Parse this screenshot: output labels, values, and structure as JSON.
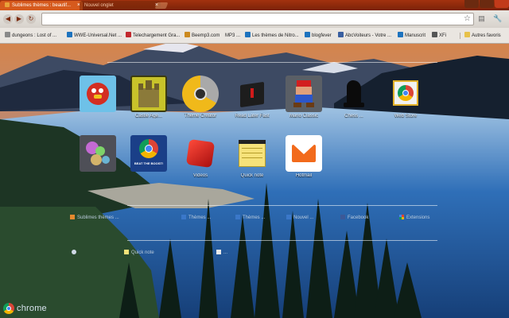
{
  "tabs": [
    {
      "label": "Sublimes thèmes : beautif...",
      "active": true
    },
    {
      "label": "Nouvel onglet",
      "active": false
    }
  ],
  "toolbar": {
    "back_icon": "back-arrow-icon",
    "omnibox_value": "",
    "star_icon": "star-icon"
  },
  "bookmarks": [
    {
      "label": "dungeons : Lost of ...",
      "icon": "D"
    },
    {
      "label": "WWE-Universal.Net ...",
      "icon": "B"
    },
    {
      "label": "Telechargement Gra...",
      "icon": "T"
    },
    {
      "label": "Beemp3.com",
      "icon": "B"
    },
    {
      "label": "MP3 ...",
      "icon": ""
    },
    {
      "label": "Les thèmes de Nitro...",
      "icon": "B"
    },
    {
      "label": "blogfever",
      "icon": "B"
    },
    {
      "label": "AbcVoiteurs - Votre ...",
      "icon": "A"
    },
    {
      "label": "Manuscrit",
      "icon": "B"
    },
    {
      "label": "XFi",
      "icon": "X"
    },
    {
      "label": "Autres favoris",
      "icon": "folder"
    }
  ],
  "apps_row1": [
    {
      "label": "",
      "icon": "angry-birds-icon"
    },
    {
      "label": "Castle Age...",
      "icon": "castle-icon"
    },
    {
      "label": "Theme Creator",
      "icon": "chrome-theme-icon"
    },
    {
      "label": "Read Later Fast",
      "icon": "read-later-icon"
    },
    {
      "label": "Mario Classic",
      "icon": "mario-icon"
    },
    {
      "label": "Chess ...",
      "icon": "chess-knight-icon"
    },
    {
      "label": "Web Store",
      "icon": "web-store-icon"
    }
  ],
  "apps_row2": [
    {
      "label": "",
      "icon": "bubbles-icon"
    },
    {
      "label": "",
      "icon": "beat-the-boost-icon",
      "badge": "BEAT THE BOOST!"
    },
    {
      "label": "Videos",
      "icon": "red-cube-icon"
    },
    {
      "label": "Quick note",
      "icon": "sticky-note-icon"
    },
    {
      "label": "Hotmail",
      "icon": "mail-icon"
    }
  ],
  "recently_closed": [
    {
      "label": "Sublimes thèmes ...",
      "icon": "orange"
    },
    {
      "label": "Thèmes ...",
      "icon": "blue"
    },
    {
      "label": "Thèmes ...",
      "icon": "blue"
    },
    {
      "label": "Nouvel ...",
      "icon": "blue"
    },
    {
      "label": "Facebook",
      "icon": "blue"
    },
    {
      "label": "Extensions",
      "icon": "multi"
    }
  ],
  "most_visited": [
    {
      "label": "",
      "icon": "globe"
    },
    {
      "label": "Quick note",
      "icon": "note"
    },
    {
      "label": "...",
      "icon": "page"
    }
  ],
  "brand": {
    "word": "chrome"
  }
}
